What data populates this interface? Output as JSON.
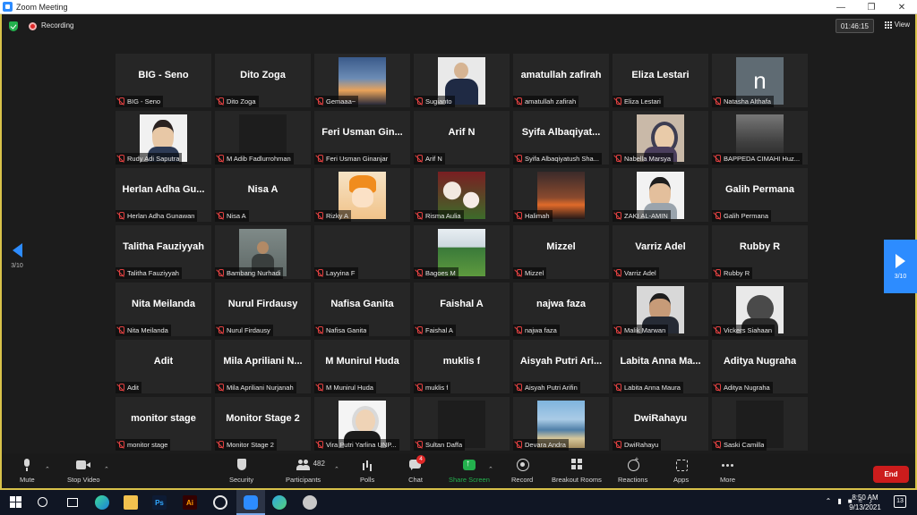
{
  "window": {
    "title": "Zoom Meeting"
  },
  "topbar": {
    "recording_label": "Recording",
    "timer": "01:46:15",
    "view_label": "View"
  },
  "paging": {
    "left_label": "3/10",
    "right_label": "3/10"
  },
  "tiles": [
    {
      "display": "BIG - Seno",
      "name": "BIG - Seno"
    },
    {
      "display": "Dito Zoga",
      "name": "Dito Zoga"
    },
    {
      "display": "",
      "name": "Gemaaa~",
      "photo": "p-sunset"
    },
    {
      "display": "",
      "name": "Sugianto",
      "photo": "p-suit"
    },
    {
      "display": "amatullah zafirah",
      "name": "amatullah zafirah"
    },
    {
      "display": "Eliza Lestari",
      "name": "Eliza Lestari"
    },
    {
      "display": "",
      "name": "Natasha Althafa",
      "photo": "p-letter",
      "letter": "n"
    },
    {
      "display": "",
      "name": "Rudy Adi Saputra",
      "photo": "p-boy"
    },
    {
      "display": "",
      "name": "M Adib Fadlurrohman",
      "photo": "p-dark"
    },
    {
      "display": "Feri Usman Gin...",
      "name": "Feri Usman Ginanjar"
    },
    {
      "display": "Arif N",
      "name": "Arif N"
    },
    {
      "display": "Syifa Albaqiyat...",
      "name": "Syifa Albaqiyatush Sha..."
    },
    {
      "display": "",
      "name": "Nabella Marsya",
      "photo": "p-hijab"
    },
    {
      "display": "",
      "name": "BAPPEDA CIMAHI Huz...",
      "photo": "p-room"
    },
    {
      "display": "Herlan Adha Gu...",
      "name": "Herlan Adha Gunawan"
    },
    {
      "display": "Nisa A",
      "name": "Nisa A"
    },
    {
      "display": "",
      "name": "Rizky A",
      "photo": "p-anime"
    },
    {
      "display": "",
      "name": "Risma Aulia",
      "photo": "p-flowers"
    },
    {
      "display": "",
      "name": "Halimah",
      "photo": "p-dusk"
    },
    {
      "display": "",
      "name": "ZAKI AL-AMIN",
      "photo": "p-man"
    },
    {
      "display": "Galih Permana",
      "name": "Galih Permana"
    },
    {
      "display": "Talitha Fauziyyah",
      "name": "Talitha Fauziyyah"
    },
    {
      "display": "",
      "name": "Bambang Nurhadi",
      "photo": "p-wall"
    },
    {
      "display": "",
      "name": "Layyina F"
    },
    {
      "display": "",
      "name": "Bagoes M",
      "photo": "p-field"
    },
    {
      "display": "Mizzel",
      "name": "Mizzel"
    },
    {
      "display": "Varriz Adel",
      "name": "Varriz Adel"
    },
    {
      "display": "Rubby R",
      "name": "Rubby R"
    },
    {
      "display": "Nita Meilanda",
      "name": "Nita Meilanda"
    },
    {
      "display": "Nurul Firdausy",
      "name": "Nurul Firdausy"
    },
    {
      "display": "Nafisa Ganita",
      "name": "Nafisa Ganita"
    },
    {
      "display": "Faishal A",
      "name": "Faishal A"
    },
    {
      "display": "najwa faza",
      "name": "najwa faza"
    },
    {
      "display": "",
      "name": "Malik Marwan",
      "photo": "p-glasses"
    },
    {
      "display": "",
      "name": "Vickers Siahaan",
      "photo": "p-sketch"
    },
    {
      "display": "Adit",
      "name": "Adit"
    },
    {
      "display": "Mila Apriliani N...",
      "name": "Mila Apriliani Nurjanah"
    },
    {
      "display": "M Munirul Huda",
      "name": "M Munirul Huda"
    },
    {
      "display": "muklis f",
      "name": "muklis f"
    },
    {
      "display": "Aisyah Putri Ari...",
      "name": "Aisyah Putri Arifin"
    },
    {
      "display": "Labita Anna Ma...",
      "name": "Labita Anna Maura"
    },
    {
      "display": "Aditya Nugraha",
      "name": "Aditya Nugraha"
    },
    {
      "display": "monitor stage",
      "name": "monitor stage"
    },
    {
      "display": "Monitor Stage 2",
      "name": "Monitor Stage 2"
    },
    {
      "display": "",
      "name": "Vira Putri Yarlina UNP...",
      "photo": "p-hijab2"
    },
    {
      "display": "",
      "name": "Sultan Daffa",
      "photo": "p-dark"
    },
    {
      "display": "",
      "name": "Devara Andra",
      "photo": "p-beach"
    },
    {
      "display": "DwiRahayu",
      "name": "DwiRahayu"
    },
    {
      "display": "",
      "name": "Saski Camilla",
      "photo": "p-dark"
    }
  ],
  "toolbar": {
    "mute": "Mute",
    "stop_video": "Stop Video",
    "security": "Security",
    "participants": "Participants",
    "participant_count": "482",
    "polls": "Polls",
    "chat": "Chat",
    "chat_badge": "4",
    "share_screen": "Share Screen",
    "record": "Record",
    "breakout_rooms": "Breakout Rooms",
    "reactions": "Reactions",
    "apps": "Apps",
    "more": "More",
    "end": "End"
  },
  "taskbar": {
    "time": "8:50 AM",
    "date": "9/13/2021",
    "notifications": "13",
    "ps": "Ps",
    "ai": "Ai"
  },
  "colors": {
    "accent": "#2d8cff",
    "end": "#cc1c1c",
    "share": "#23b14d",
    "border": "#d8c24a"
  }
}
